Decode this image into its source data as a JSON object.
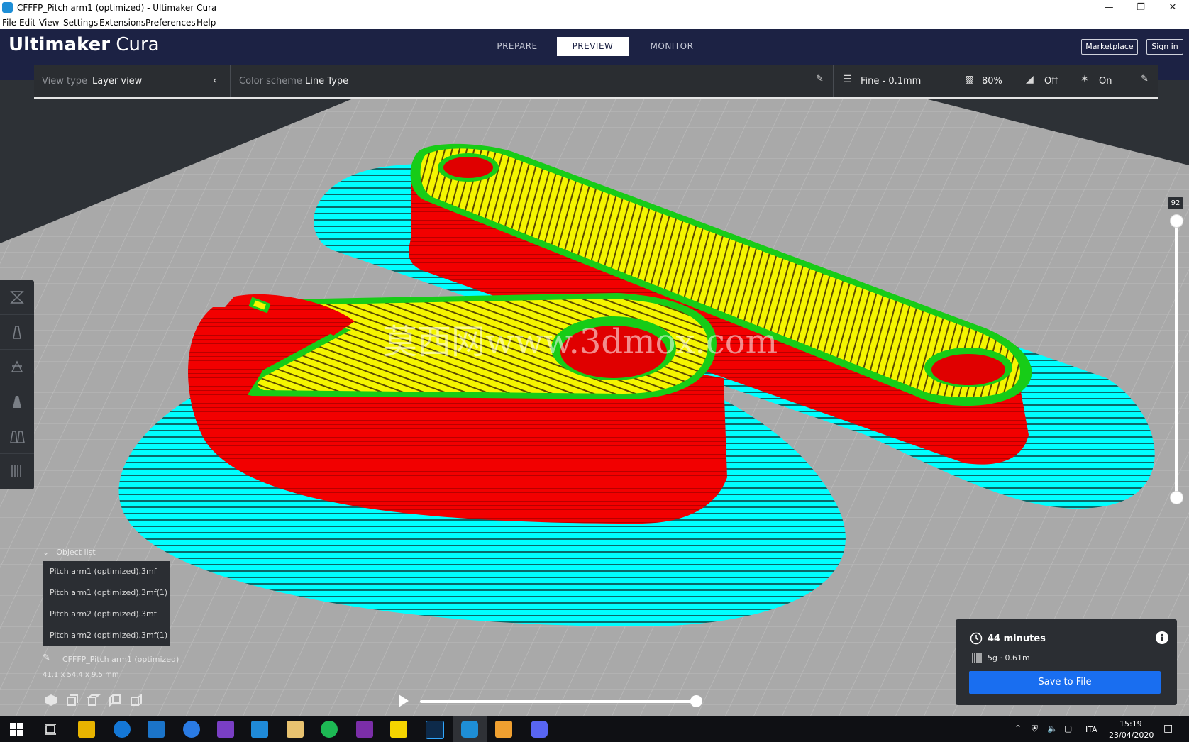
{
  "window": {
    "title": "CFFFP_Pitch arm1 (optimized) - Ultimaker Cura",
    "controls": [
      "minimize",
      "restore",
      "close"
    ]
  },
  "menu": [
    "File",
    "Edit",
    "View",
    "Settings",
    "Extensions",
    "Preferences",
    "Help"
  ],
  "header": {
    "logo_bold": "Ultimaker",
    "logo_light": " Cura",
    "stages": [
      "PREPARE",
      "PREVIEW",
      "MONITOR"
    ],
    "active_stage": "PREVIEW",
    "marketplace_label": "Marketplace",
    "signin_label": "Sign in"
  },
  "viewpanel": {
    "view_type_label": "View type",
    "view_type_value": "Layer view",
    "color_scheme_label": "Color scheme",
    "color_scheme_value": "Line Type",
    "profile": "Fine - 0.1mm",
    "infill": "80%",
    "support": "Off",
    "adhesion": "On"
  },
  "watermark": "莫西网www.3dmox.com",
  "layer": {
    "current": "92"
  },
  "object_list": {
    "header": "Object list",
    "items": [
      "Pitch arm1 (optimized).3mf",
      "Pitch arm1 (optimized).3mf(1)",
      "Pitch arm2 (optimized).3mf",
      "Pitch arm2 (optimized).3mf(1)"
    ],
    "selected_name": "CFFFP_Pitch arm1 (optimized)",
    "dimensions": "41.1 x 54.4 x 9.5 mm"
  },
  "estimate": {
    "time": "44 minutes",
    "material": "5g · 0.61m",
    "save_label": "Save to File"
  },
  "playback": {
    "progress": 1.0
  },
  "taskbar": {
    "language": "ITA",
    "time": "15:19",
    "date": "23/04/2020"
  },
  "colors": {
    "header_bg": "#1c2244",
    "panel_bg": "#2b2e33",
    "accent_blue": "#196ef0",
    "wall_red": "#f20000",
    "infill_yellow": "#f5f500",
    "inner_green": "#17cc17",
    "skirt_cyan": "#00ffff"
  }
}
